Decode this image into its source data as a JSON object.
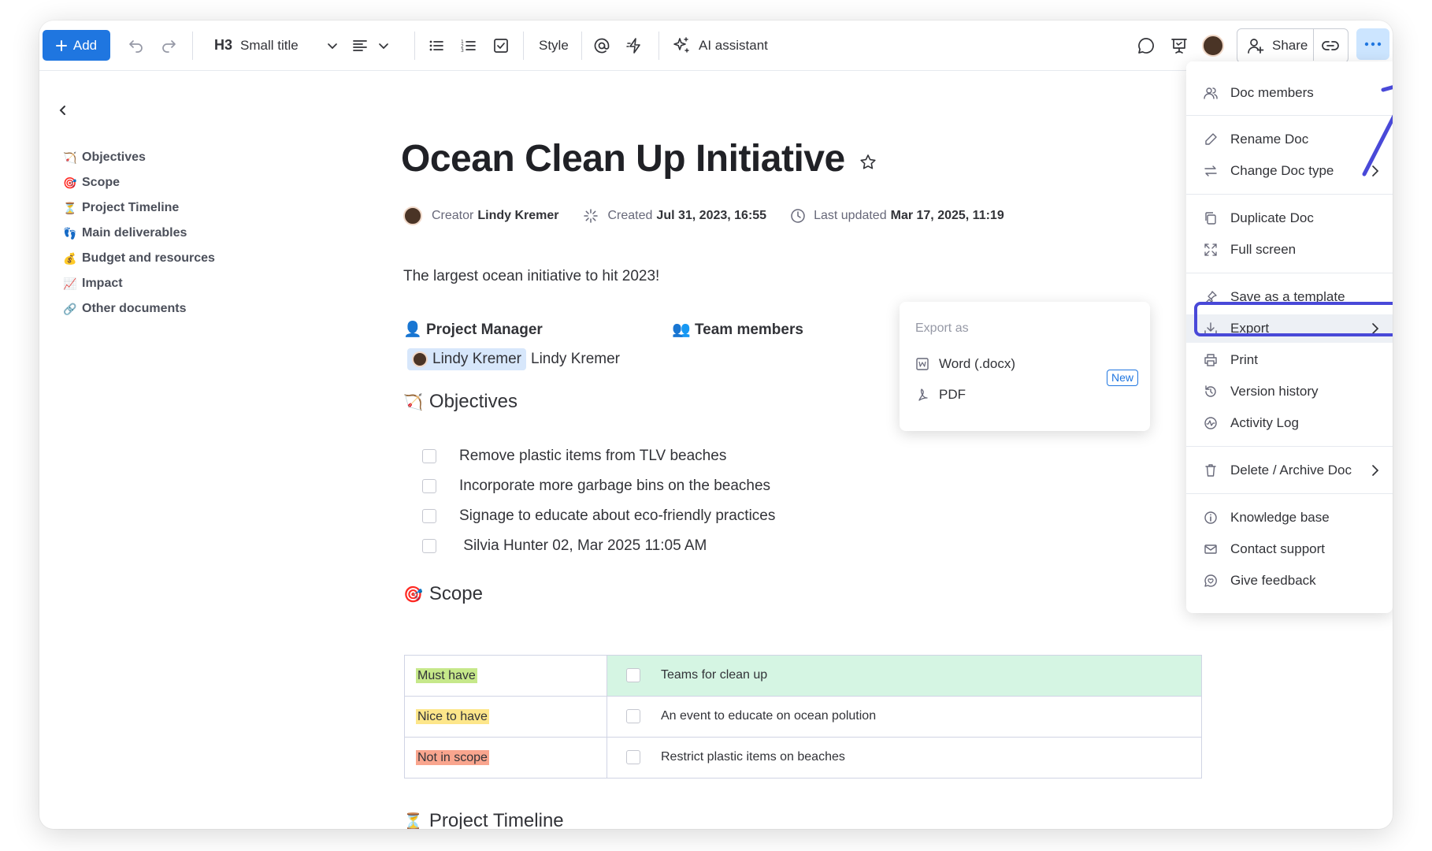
{
  "toolbar": {
    "add_label": "Add",
    "heading_prefix": "H3",
    "heading_label": "Small title",
    "style_label": "Style",
    "ai_label": "AI assistant",
    "share_label": "Share"
  },
  "nav": {
    "items": [
      {
        "emoji": "🏹",
        "label": "Objectives"
      },
      {
        "emoji": "🎯",
        "label": "Scope"
      },
      {
        "emoji": "⏳",
        "label": "Project Timeline"
      },
      {
        "emoji": "👣",
        "label": "Main deliverables"
      },
      {
        "emoji": "💰",
        "label": "Budget and resources"
      },
      {
        "emoji": "📈",
        "label": "Impact"
      },
      {
        "emoji": "🔗",
        "label": "Other documents"
      }
    ]
  },
  "doc": {
    "title": "Ocean Clean Up Initiative",
    "meta": {
      "creator_label": "Creator",
      "creator_name": "Lindy Kremer",
      "created_label": "Created",
      "created_value": "Jul 31, 2023, 16:55",
      "updated_label": "Last updated",
      "updated_value": "Mar 17, 2025, 11:19"
    },
    "subtitle": "The largest ocean initiative to hit 2023!",
    "pm_label": "Project Manager",
    "pm_emoji": "👤",
    "tm_label": "Team members",
    "tm_emoji": "👥",
    "pm_chip": "Lindy Kremer",
    "pm_text": "Lindy Kremer",
    "objectives": {
      "emoji": "🏹",
      "heading": "Objectives",
      "items": [
        "Remove plastic items from TLV beaches",
        "Incorporate more garbage bins on the beaches",
        "Signage to educate about eco-friendly practices",
        " Silvia Hunter 02, Mar 2025 11:05 AM"
      ]
    },
    "scope": {
      "emoji": "🎯",
      "heading": "Scope",
      "rows": [
        {
          "tag": "Must have",
          "tag_color": "#c6e88a",
          "item": "Teams for clean up",
          "row_bg": "#d5f5e3"
        },
        {
          "tag": "Nice to have",
          "tag_color": "#fde68a",
          "item": "An event to educate on ocean polution",
          "row_bg": "#ffffff"
        },
        {
          "tag": "Not in scope",
          "tag_color": "#f9a58e",
          "item": "Restrict plastic items on beaches",
          "row_bg": "#ffffff"
        }
      ]
    },
    "timeline": {
      "emoji": "⏳",
      "heading": "Project Timeline"
    }
  },
  "export_menu": {
    "header": "Export as",
    "word_label": "Word (.docx)",
    "new_badge": "New",
    "pdf_label": "PDF"
  },
  "main_menu": {
    "doc_members": "Doc members",
    "rename": "Rename Doc",
    "change_type": "Change Doc type",
    "duplicate": "Duplicate Doc",
    "full_screen": "Full screen",
    "save_template": "Save as a template",
    "export": "Export",
    "print": "Print",
    "version_history": "Version history",
    "activity_log": "Activity Log",
    "delete_archive": "Delete / Archive Doc",
    "knowledge_base": "Knowledge base",
    "contact_support": "Contact support",
    "give_feedback": "Give feedback"
  },
  "colors": {
    "accent": "#1f76e0",
    "highlight": "#4949d8",
    "more_btn_bg": "#cce5ff"
  }
}
